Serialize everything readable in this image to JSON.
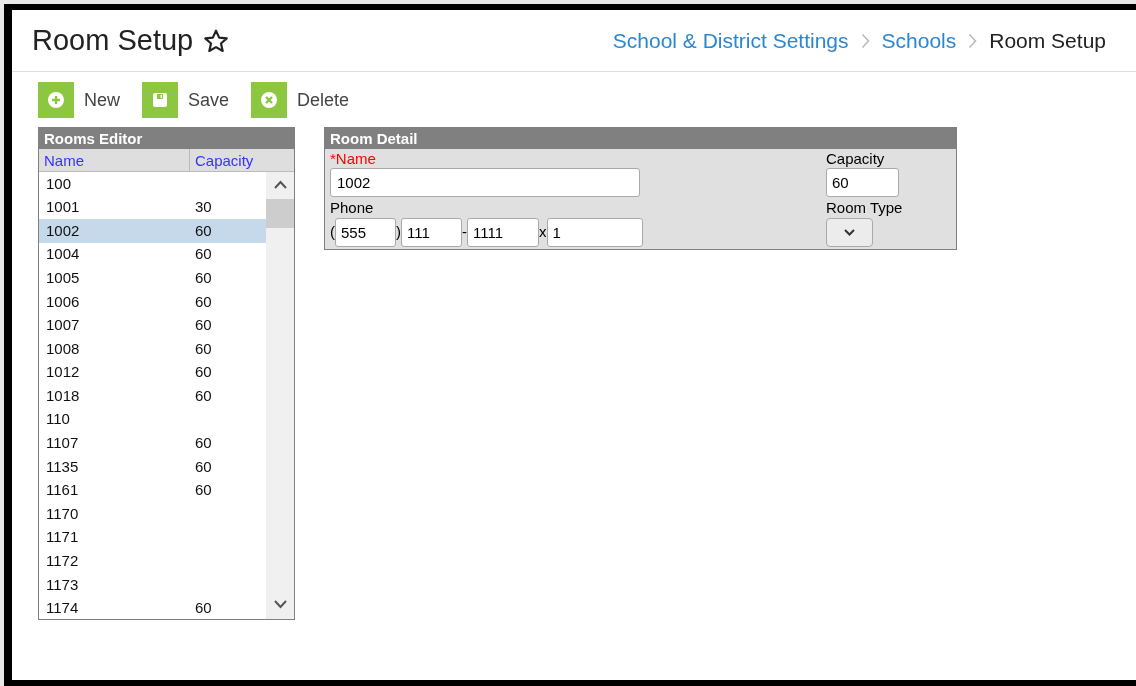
{
  "header": {
    "title": "Room Setup",
    "breadcrumb": [
      {
        "label": "School & District Settings",
        "kind": "link"
      },
      {
        "label": "Schools",
        "kind": "link"
      },
      {
        "label": "Room Setup",
        "kind": "current"
      }
    ]
  },
  "toolbar": [
    {
      "label": "New",
      "kind": "new"
    },
    {
      "label": "Save",
      "kind": "save"
    },
    {
      "label": "Delete",
      "kind": "delete"
    }
  ],
  "rooms_editor": {
    "title": "Rooms Editor",
    "columns": [
      "Name",
      "Capacity"
    ],
    "rows": [
      {
        "name": "100",
        "capacity": "",
        "selected": false
      },
      {
        "name": "1001",
        "capacity": "30",
        "selected": false
      },
      {
        "name": "1002",
        "capacity": "60",
        "selected": true
      },
      {
        "name": "1004",
        "capacity": "60",
        "selected": false
      },
      {
        "name": "1005",
        "capacity": "60",
        "selected": false
      },
      {
        "name": "1006",
        "capacity": "60",
        "selected": false
      },
      {
        "name": "1007",
        "capacity": "60",
        "selected": false
      },
      {
        "name": "1008",
        "capacity": "60",
        "selected": false
      },
      {
        "name": "1012",
        "capacity": "60",
        "selected": false
      },
      {
        "name": "1018",
        "capacity": "60",
        "selected": false
      },
      {
        "name": "110",
        "capacity": "",
        "selected": false
      },
      {
        "name": "1107",
        "capacity": "60",
        "selected": false
      },
      {
        "name": "1135",
        "capacity": "60",
        "selected": false
      },
      {
        "name": "1161",
        "capacity": "60",
        "selected": false
      },
      {
        "name": "1170",
        "capacity": "",
        "selected": false
      },
      {
        "name": "1171",
        "capacity": "",
        "selected": false
      },
      {
        "name": "1172",
        "capacity": "",
        "selected": false
      },
      {
        "name": "1173",
        "capacity": "",
        "selected": false
      },
      {
        "name": "1174",
        "capacity": "60",
        "selected": false
      }
    ]
  },
  "room_detail": {
    "title": "Room Detail",
    "name_label": "*Name",
    "name_value": "1002",
    "capacity_label": "Capacity",
    "capacity_value": "60",
    "phone_label": "Phone",
    "phone": {
      "open_paren": "(",
      "area": "555",
      "close_paren": ")",
      "prefix": "111",
      "dash": "-",
      "line": "1111",
      "ext_sep": "x",
      "ext": "1"
    },
    "room_type_label": "Room Type"
  }
}
